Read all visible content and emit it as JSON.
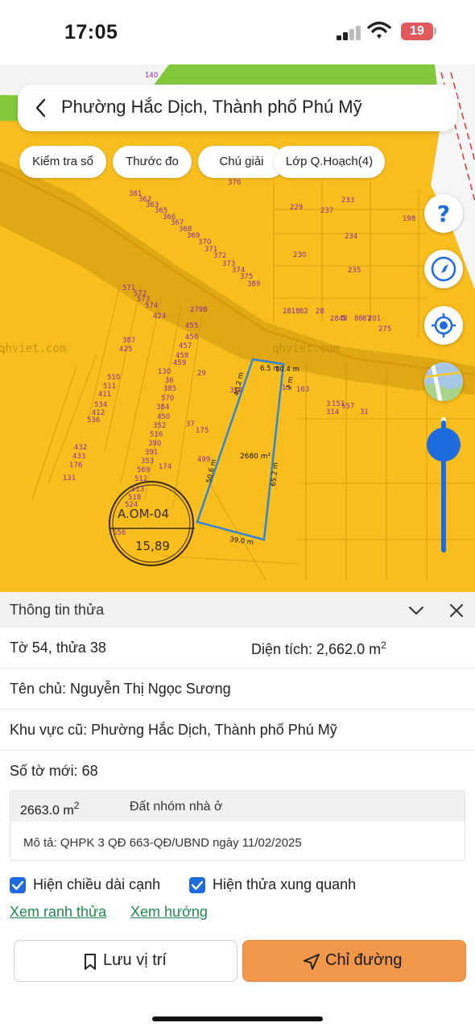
{
  "status_bar": {
    "time": "17:05",
    "battery_level": "19"
  },
  "header": {
    "title": "Phường Hắc Dịch, Thành phố Phú Mỹ"
  },
  "toolbar_chips": [
    "Kiểm tra sổ",
    "Thước đo",
    "Chú giải",
    "Lớp Q.Hoạch(4)"
  ],
  "map": {
    "watermark": "qhviet.com",
    "zone_code": "A.OM-04",
    "zone_value": "15,89",
    "parcel_area_label": "2680 m²",
    "parcel_number": "38",
    "edge_lengths": [
      "6.5 m",
      "10.4 m",
      "2 m",
      "65.2 m",
      "39.0 m",
      "50.6 m",
      "40.2 m"
    ],
    "parcel_numbers": [
      "140",
      "376",
      "229",
      "237",
      "233",
      "198",
      "234",
      "230",
      "235",
      "381",
      "362",
      "363",
      "365",
      "366",
      "367",
      "368",
      "369",
      "370",
      "371",
      "372",
      "373",
      "374",
      "375",
      "389",
      "571",
      "572",
      "573",
      "574",
      "424",
      "2798",
      "2818",
      "82",
      "28",
      "2848",
      "5",
      "86",
      "87",
      "201",
      "275",
      "387",
      "425",
      "455",
      "456",
      "457",
      "458",
      "459",
      "130",
      "29",
      "510",
      "511",
      "411",
      "534",
      "412",
      "536",
      "36",
      "385",
      "570",
      "384",
      "450",
      "352",
      "516",
      "390",
      "391",
      "353",
      "569",
      "512",
      "513",
      "518",
      "524",
      "556",
      "37",
      "175",
      "499",
      "432",
      "433",
      "176",
      "131",
      "174",
      "312",
      "13",
      "163",
      "3",
      "151",
      "557",
      "314",
      "31"
    ]
  },
  "map_controls": {
    "help": "help-icon",
    "compass": "compass-icon",
    "locate": "locate-icon",
    "satellite": "satellite-layer-icon"
  },
  "panel": {
    "title": "Thông tin thửa",
    "sheet_parcel": "Tờ 54, thửa 38",
    "area_label": "Diện tích: 2,662.0 m",
    "area_sup": "2",
    "owner": "Tên chủ: Nguyễn Thị Ngọc Sương",
    "old_area": "Khu vực cũ: Phường Hắc Dịch, Thành phố Phú Mỹ",
    "new_sheet": "Số tờ mới: 68",
    "plan": {
      "area": "2663.0 m",
      "area_sup": "2",
      "type": "Đất nhóm nhà ở",
      "description": "Mô tả: QHPK 3 QĐ 663-QĐ/UBND ngày 11/02/2025"
    },
    "check_edges": "Hiện chiều dài cạnh",
    "check_neighbors": "Hiện thửa xung quanh",
    "link_boundary": "Xem ranh thửa",
    "link_direction": "Xem hướng",
    "btn_save": "Lưu vị trí",
    "btn_directions": "Chỉ đường"
  },
  "colors": {
    "map_zone": "#f8be1e",
    "accent_blue": "#1e6be0",
    "link_green": "#1e8a4e",
    "primary_button": "#f0974a",
    "parcel_outline": "#2f86d9",
    "lot_label": "#8a2aa0"
  }
}
